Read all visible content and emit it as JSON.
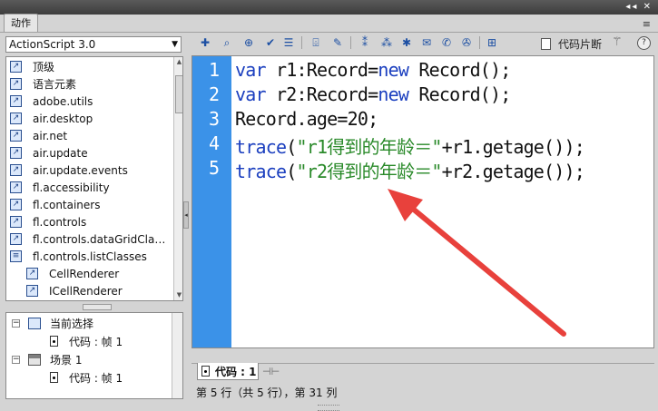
{
  "panel": {
    "tab_label": "动作"
  },
  "toolbox": {
    "version_selected": "ActionScript 3.0",
    "items": [
      {
        "label": "顶级",
        "sub": false
      },
      {
        "label": "语言元素",
        "sub": false
      },
      {
        "label": "adobe.utils",
        "sub": false
      },
      {
        "label": "air.desktop",
        "sub": false
      },
      {
        "label": "air.net",
        "sub": false
      },
      {
        "label": "air.update",
        "sub": false
      },
      {
        "label": "air.update.events",
        "sub": false
      },
      {
        "label": "fl.accessibility",
        "sub": false
      },
      {
        "label": "fl.containers",
        "sub": false
      },
      {
        "label": "fl.controls",
        "sub": false
      },
      {
        "label": "fl.controls.dataGridCla…",
        "sub": false
      },
      {
        "label": "fl.controls.listClasses",
        "sub": false
      },
      {
        "label": "CellRenderer",
        "sub": true
      },
      {
        "label": "ICellRenderer",
        "sub": true
      }
    ]
  },
  "navigator": {
    "current_selection": "当前选择",
    "current_frame": "代码 : 帧 1",
    "scene": "场景 1",
    "scene_frame": "代码 : 帧 1"
  },
  "toolbar": {
    "snippets_label": "代码片断",
    "help_glyph": "?"
  },
  "editor": {
    "line_numbers": [
      "1",
      "2",
      "3",
      "4",
      "5"
    ],
    "lines": [
      {
        "kw1": "var",
        "t1": " r1:Record=",
        "kw2": "new",
        "t2": " Record();"
      },
      {
        "kw1": "var",
        "t1": " r2:Record=",
        "kw2": "new",
        "t2": " Record();"
      },
      {
        "plain": "Record.age=20;"
      },
      {
        "kw1": "trace",
        "t1": "(",
        "str": "\"r1得到的年龄＝\"",
        "t2": "+r1.getage());"
      },
      {
        "kw1": "trace",
        "t1": "(",
        "str": "\"r2得到的年龄＝\"",
        "t2": "+r2.getage());"
      }
    ]
  },
  "bottom": {
    "code_tab_label": "代码 : 1",
    "status": "第 5 行（共 5 行），第 31 列"
  },
  "colors": {
    "gutter": "#3b92e8",
    "keyword": "#1b3fbf",
    "string": "#2a8a2a",
    "arrow": "#e8413c"
  }
}
